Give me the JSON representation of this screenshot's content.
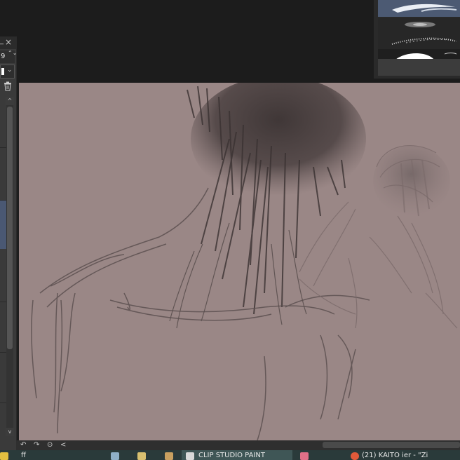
{
  "left_panel": {
    "dash_label": "_",
    "spin_value": "9",
    "spin_arrows": "⌃⌄",
    "dropdown_arrow": "⌄",
    "scroll_up_arrow": "^",
    "scroll_down_arrow": "v"
  },
  "canvas_toolbar": {
    "undo_glyph": "↶",
    "redo_glyph": "↷",
    "rotate_glyph": "⊙",
    "left_glyph": "<"
  },
  "taskbar": {
    "left_text": "ff",
    "active_window": "CLIP STUDIO PAINT",
    "right_text": "(21) KAITO ier - \"Zi"
  },
  "colors": {
    "canvas": "#9a8786",
    "ui_dark": "#1c1c1c",
    "selected_brush": "#4c5a73",
    "taskbar": "#2a3a3a"
  },
  "icons": [
    "close-icon",
    "trash-icon",
    "brush-stroke-icon",
    "undo-icon",
    "redo-icon",
    "rotate-icon",
    "chevron-left-icon",
    "paint-app-icon",
    "browser-icon",
    "folder-icon",
    "pencil-icon"
  ]
}
